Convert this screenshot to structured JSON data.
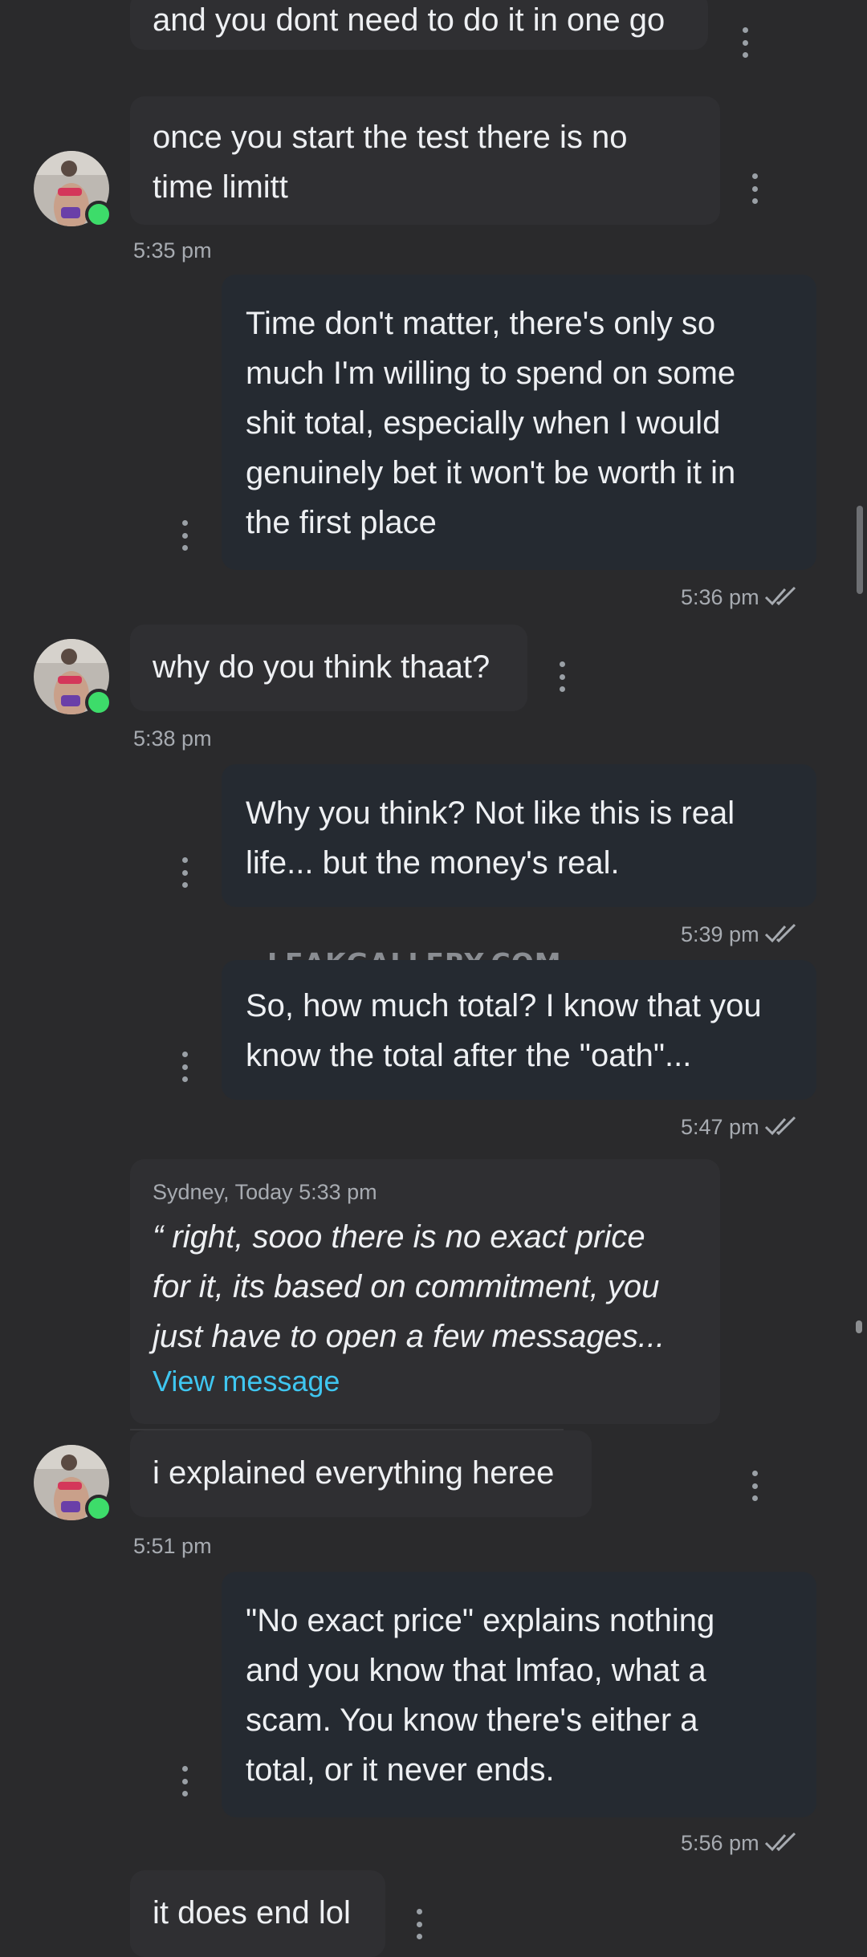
{
  "colors": {
    "background": "#2a2a2c",
    "incoming_bubble": "#2f2f32",
    "outgoing_bubble": "#252a31",
    "online_dot": "#3ddc6a",
    "link": "#3fc6f0"
  },
  "watermark": "LEAKGALLERY.COM",
  "messages": {
    "m1": {
      "text": "and you dont need to do it in one go"
    },
    "m2": {
      "line1": "once you start the test there is no",
      "line2": "time limitt",
      "time": "5:35 pm"
    },
    "m3": {
      "lines": [
        "Time don't matter, there's only so",
        "much I'm willing to spend on some",
        "shit total, especially when I would",
        "genuinely bet it won't be worth it in",
        "the first place"
      ],
      "time": "5:36 pm"
    },
    "m4": {
      "text": "why do you think thaat?",
      "time": "5:38 pm"
    },
    "m5": {
      "lines": [
        "Why you think? Not like this is real",
        "life... but the money's real."
      ],
      "time": "5:39 pm"
    },
    "m6": {
      "lines": [
        "So, how much total? I know that you",
        "know the total after the \"oath\"..."
      ],
      "time": "5:47 pm"
    },
    "quote": {
      "meta": "Sydney, Today 5:33 pm",
      "lines": [
        "“ right, sooo there is no exact price",
        "for it, its based on commitment, you",
        "just have to open a few messages..."
      ],
      "link": "View message"
    },
    "m7": {
      "text": "i explained everything heree",
      "time": "5:51 pm"
    },
    "m8": {
      "lines": [
        "\"No exact price\" explains nothing",
        "and you know that lmfao, what a",
        "scam. You know there's either a",
        "total, or it never ends."
      ],
      "time": "5:56 pm"
    },
    "m9": {
      "text": "it does end lol"
    }
  }
}
